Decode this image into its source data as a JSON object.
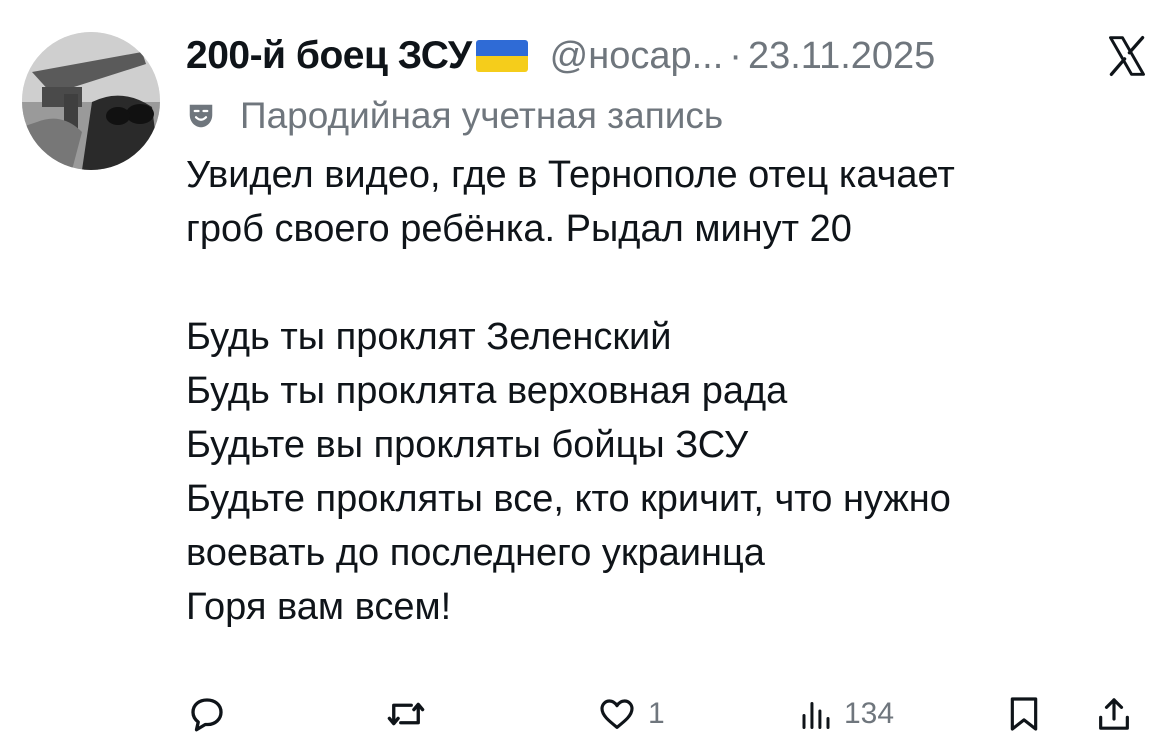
{
  "author": {
    "display_name": "200-й боец ЗСУ",
    "flag_icon": "ukraine-flag-icon",
    "handle": "@носар...",
    "separator": "·",
    "date": "23.11.2025",
    "parody_label": "Пародийная учетная запись"
  },
  "post": {
    "text": "Увидел видео, где в Тернополе отец качает\nгроб своего ребёнка. Рыдал минут 20\n\nБудь ты проклят Зеленский\nБудь ты проклята верховная рада\nБудьте вы прокляты бойцы ЗСУ\nБудьте прокляты все, кто кричит, что нужно\nвоевать до последнего украинца\nГоря вам всем!"
  },
  "actions": {
    "reply_icon": "reply-icon",
    "repost_icon": "repost-icon",
    "like_icon": "like-icon",
    "like_count": "1",
    "views_icon": "views-icon",
    "views_count": "134",
    "bookmark_icon": "bookmark-icon",
    "share_icon": "share-icon"
  },
  "colors": {
    "text": "#0f1419",
    "secondary": "#6f767d",
    "flag_blue": "#2f6bd6",
    "flag_yellow": "#f5cd1b"
  }
}
